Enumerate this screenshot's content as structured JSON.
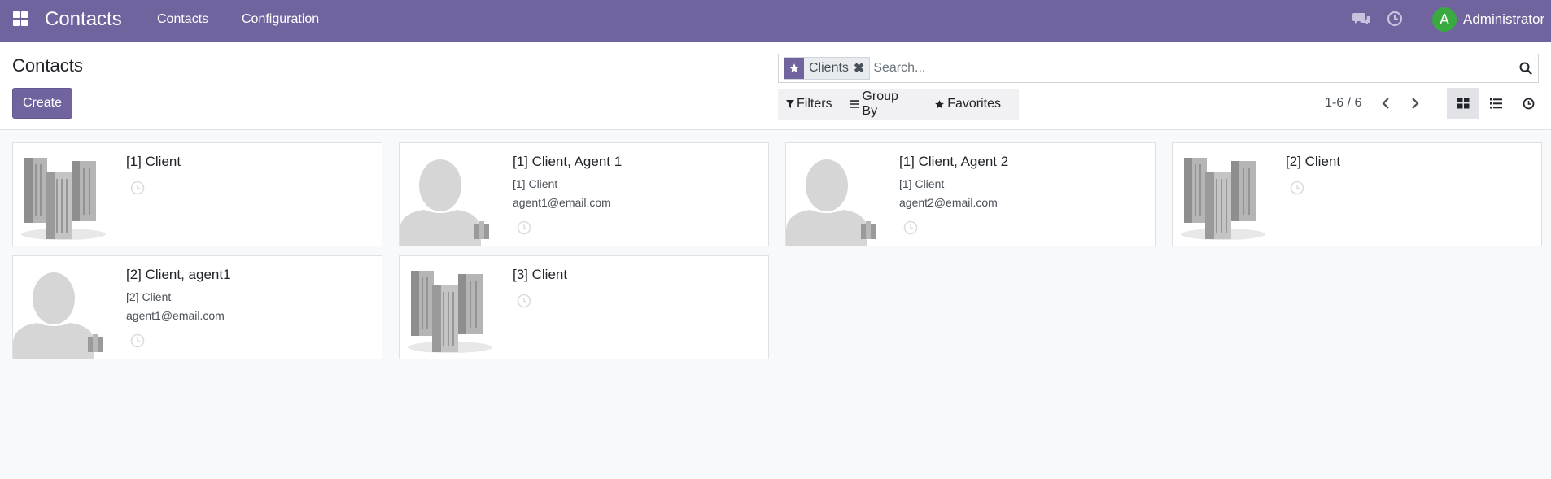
{
  "navbar": {
    "brand": "Contacts",
    "menu": [
      "Contacts",
      "Configuration"
    ],
    "user_initial": "A",
    "user_name": "Administrator"
  },
  "control_panel": {
    "title": "Contacts",
    "create_label": "Create",
    "search": {
      "facet_label": "Clients",
      "placeholder": "Search..."
    },
    "filters": [
      "Filters",
      "Group By",
      "Favorites"
    ],
    "pager": "1-6 / 6"
  },
  "cards": [
    {
      "name": "[1] Client",
      "company": "",
      "email": "",
      "type": "company"
    },
    {
      "name": "[1] Client, Agent 1",
      "company": "[1] Client",
      "email": "agent1@email.com",
      "type": "person"
    },
    {
      "name": "[1] Client, Agent 2",
      "company": "[1] Client",
      "email": "agent2@email.com",
      "type": "person"
    },
    {
      "name": "[2] Client",
      "company": "",
      "email": "",
      "type": "company"
    },
    {
      "name": "[2] Client, agent1",
      "company": "[2] Client",
      "email": "agent1@email.com",
      "type": "person"
    },
    {
      "name": "[3] Client",
      "company": "",
      "email": "",
      "type": "company"
    }
  ],
  "colors": {
    "brand": "#71639e",
    "avatar": "#3aa940"
  }
}
